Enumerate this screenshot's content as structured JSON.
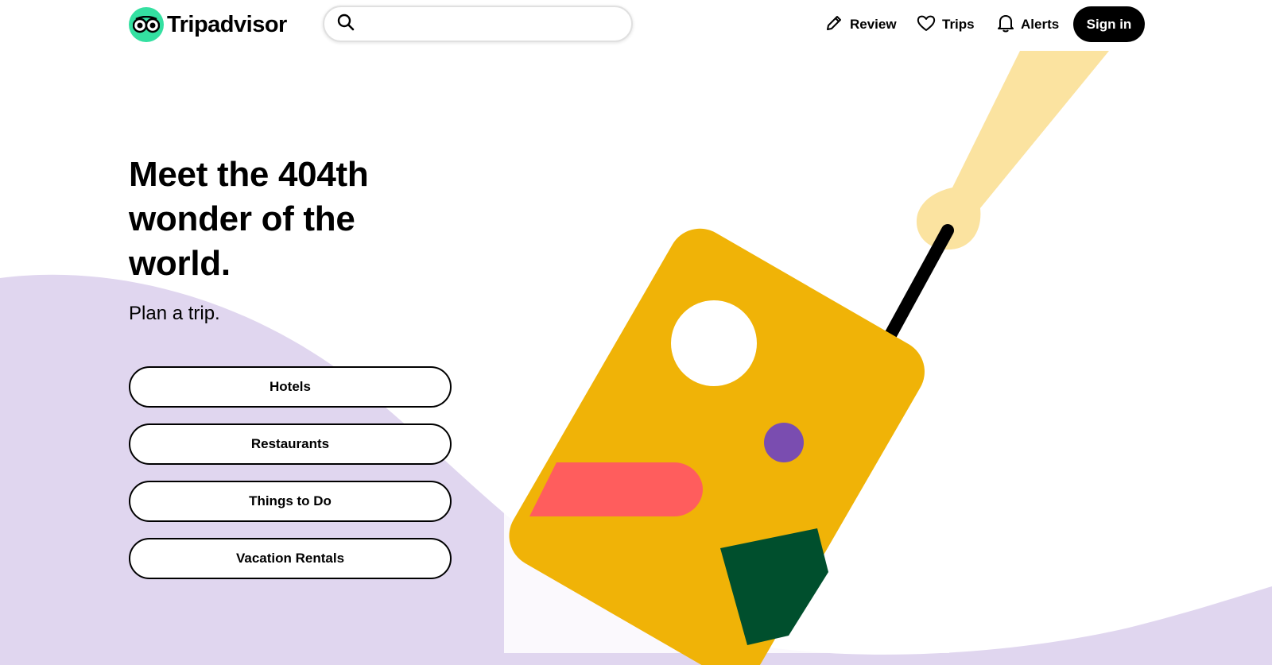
{
  "header": {
    "logo_text": "Tripadvisor",
    "search": {
      "placeholder": "",
      "icon": "search-icon"
    },
    "nav": [
      {
        "label": "Review",
        "icon": "pencil-icon"
      },
      {
        "label": "Trips",
        "icon": "heart-icon"
      },
      {
        "label": "Alerts",
        "icon": "bell-icon"
      }
    ],
    "signin_label": "Sign in"
  },
  "hero": {
    "title": "Meet the 404th wonder of the world.",
    "subtitle": "Plan a trip.",
    "options": [
      "Hotels",
      "Restaurants",
      "Things to Do",
      "Vacation Rentals"
    ]
  },
  "colors": {
    "brand_green": "#34e0a1",
    "lavender": "#e0d6ef",
    "suitcase_yellow": "#f0b307",
    "handle_cream": "#fbe3a0",
    "stripe_red": "#ff5d5d",
    "dot_purple": "#7a4db0",
    "patch_green": "#004f2d"
  }
}
